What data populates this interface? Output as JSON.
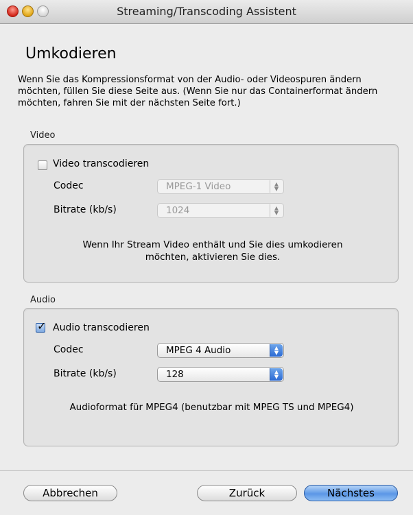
{
  "window": {
    "title": "Streaming/Transcoding Assistent"
  },
  "page": {
    "heading": "Umkodieren",
    "intro": "Wenn Sie das Kompressionsformat von der Audio- oder Videospuren ändern möchten, füllen Sie diese Seite aus. (Wenn Sie nur das Containerformat ändern möchten, fahren Sie mit der nächsten Seite fort.)"
  },
  "video": {
    "group_label": "Video",
    "checkbox_label": "Video transcodieren",
    "checked": false,
    "codec_label": "Codec",
    "codec_value": "MPEG-1 Video",
    "bitrate_label": "Bitrate (kb/s)",
    "bitrate_value": "1024",
    "info": "Wenn Ihr Stream Video enthält und Sie dies umkodieren möchten, aktivieren Sie dies."
  },
  "audio": {
    "group_label": "Audio",
    "checkbox_label": "Audio transcodieren",
    "checked": true,
    "codec_label": "Codec",
    "codec_value": "MPEG 4 Audio",
    "bitrate_label": "Bitrate (kb/s)",
    "bitrate_value": "128",
    "info": "Audioformat für MPEG4 (benutzbar mit MPEG TS und MPEG4)"
  },
  "buttons": {
    "cancel": "Abbrechen",
    "back": "Zurück",
    "next": "Nächstes"
  }
}
